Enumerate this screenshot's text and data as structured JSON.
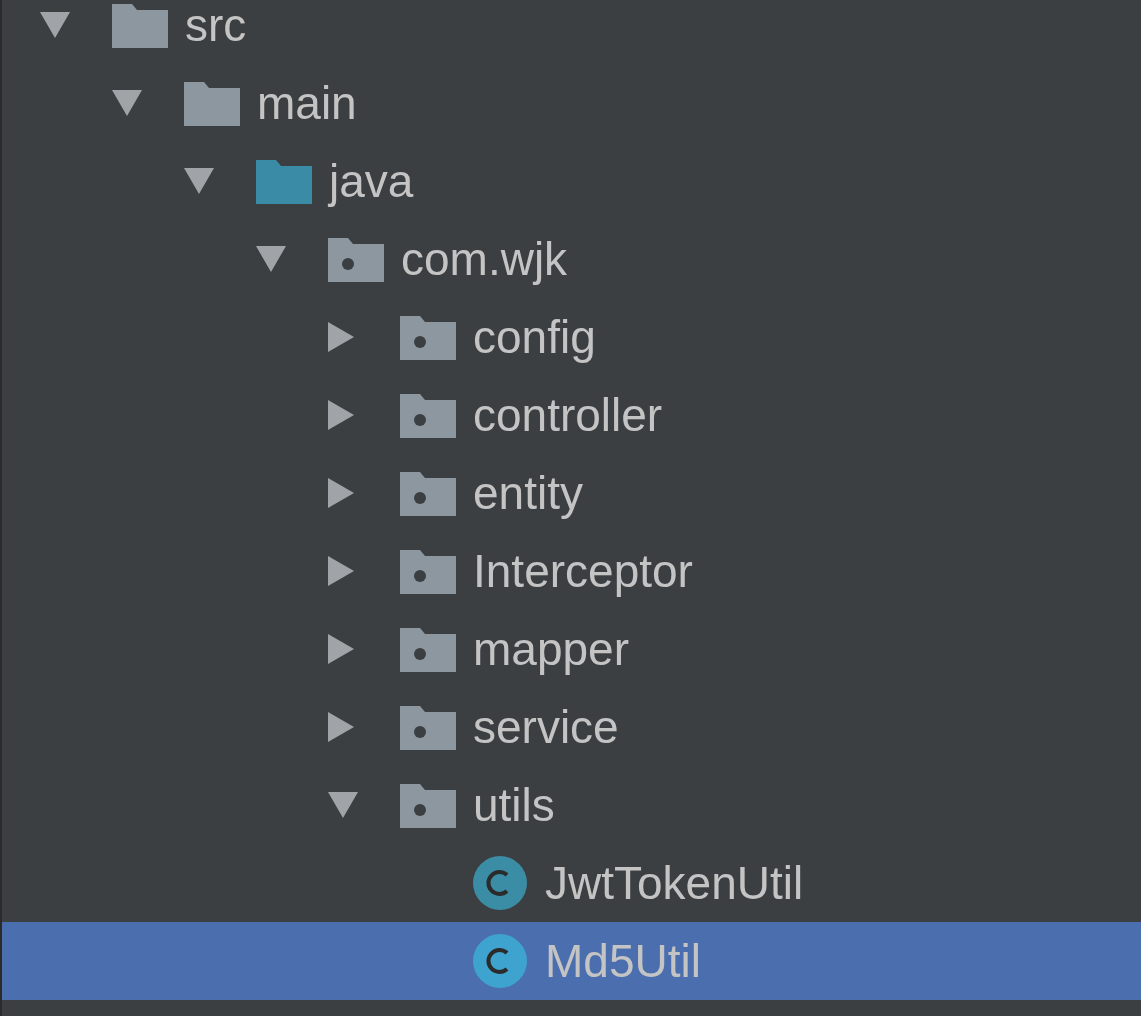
{
  "tree": [
    {
      "kind": "folder",
      "label": "src",
      "expanded": true,
      "selected": false,
      "children": [
        {
          "kind": "folder",
          "label": "main",
          "expanded": true,
          "selected": false,
          "children": [
            {
              "kind": "source-root",
              "label": "java",
              "expanded": true,
              "selected": false,
              "children": [
                {
                  "kind": "package",
                  "label": "com.wjk",
                  "expanded": true,
                  "selected": false,
                  "children": [
                    {
                      "kind": "package",
                      "label": "config",
                      "expanded": false,
                      "selected": false
                    },
                    {
                      "kind": "package",
                      "label": "controller",
                      "expanded": false,
                      "selected": false
                    },
                    {
                      "kind": "package",
                      "label": "entity",
                      "expanded": false,
                      "selected": false
                    },
                    {
                      "kind": "package",
                      "label": "Interceptor",
                      "expanded": false,
                      "selected": false
                    },
                    {
                      "kind": "package",
                      "label": "mapper",
                      "expanded": false,
                      "selected": false
                    },
                    {
                      "kind": "package",
                      "label": "service",
                      "expanded": false,
                      "selected": false
                    },
                    {
                      "kind": "package",
                      "label": "utils",
                      "expanded": true,
                      "selected": false,
                      "children": [
                        {
                          "kind": "class",
                          "label": "JwtTokenUtil",
                          "selected": false
                        },
                        {
                          "kind": "class",
                          "label": "Md5Util",
                          "selected": true
                        }
                      ]
                    }
                  ]
                }
              ]
            }
          ]
        }
      ]
    }
  ]
}
